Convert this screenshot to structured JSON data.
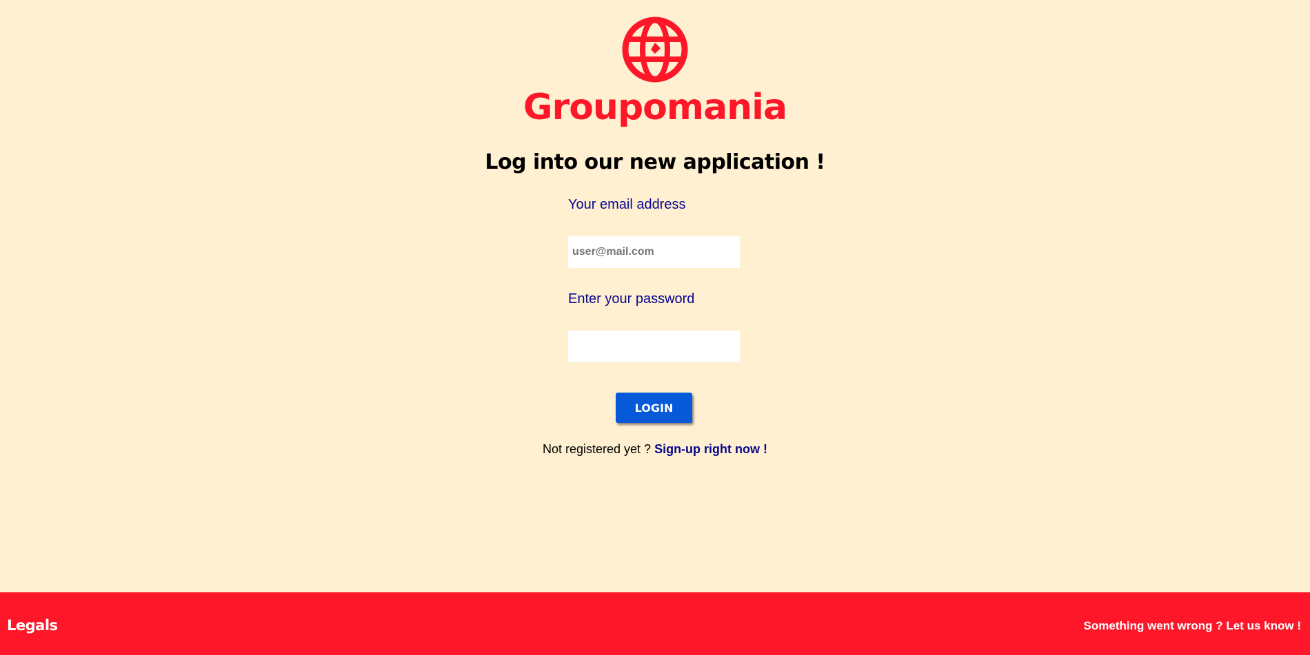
{
  "brand": {
    "name": "Groupomania",
    "color": "#fd1728",
    "logo_icon": "globe-icon"
  },
  "login": {
    "headline": "Log into our new application !",
    "email_label": "Your email address",
    "email_placeholder": "user@mail.com",
    "email_value": "",
    "password_label": "Enter your password",
    "password_value": "",
    "button_label": "LOGIN",
    "button_color": "#0659d8",
    "signup_prompt": "Not registered yet ? ",
    "signup_link": "Sign-up right now !"
  },
  "footer": {
    "legals": "Legals",
    "report": "Something went wrong ? Let us know !",
    "background": "#fd1728"
  },
  "colors": {
    "page_background": "#fff0d2",
    "label_text": "#07068c"
  }
}
